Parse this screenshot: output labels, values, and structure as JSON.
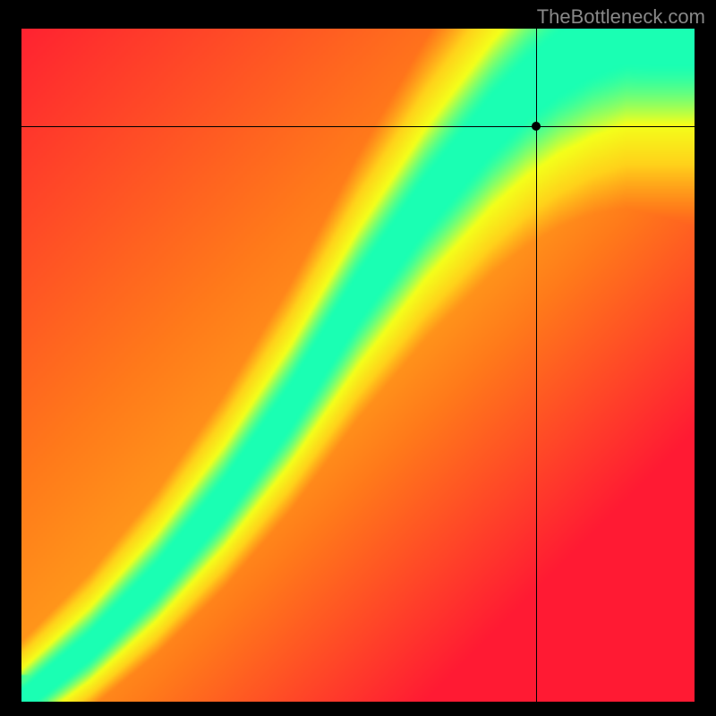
{
  "watermark": "TheBottleneck.com",
  "chart_data": {
    "type": "heatmap",
    "title": "",
    "xlabel": "",
    "ylabel": "",
    "xlim": [
      0,
      1
    ],
    "ylim": [
      0,
      1
    ],
    "grid": false,
    "legend": false,
    "marker": {
      "x": 0.765,
      "y": 0.855
    },
    "crosshair": {
      "x": 0.765,
      "y": 0.855
    },
    "colormap": [
      "#ff1a33",
      "#ff7a1a",
      "#ffd21a",
      "#f4ff1a",
      "#1affb3"
    ],
    "ridge": {
      "description": "optimal diagonal band (green) from bottom-left toward upper-right, with slight S-curve",
      "points_xy": [
        [
          0.0,
          0.0
        ],
        [
          0.05,
          0.04
        ],
        [
          0.1,
          0.08
        ],
        [
          0.15,
          0.13
        ],
        [
          0.2,
          0.18
        ],
        [
          0.25,
          0.24
        ],
        [
          0.3,
          0.3
        ],
        [
          0.35,
          0.37
        ],
        [
          0.4,
          0.44
        ],
        [
          0.45,
          0.52
        ],
        [
          0.5,
          0.6
        ],
        [
          0.55,
          0.67
        ],
        [
          0.6,
          0.74
        ],
        [
          0.65,
          0.8
        ],
        [
          0.7,
          0.86
        ],
        [
          0.75,
          0.91
        ],
        [
          0.8,
          0.95
        ],
        [
          0.85,
          0.98
        ],
        [
          0.9,
          1.0
        ]
      ],
      "band_halfwidth": 0.045
    },
    "corner_values": {
      "bottom_left": "green_origin",
      "top_left": "red",
      "bottom_right": "red",
      "top_right": "yellow"
    }
  },
  "colors": {
    "background": "#000000",
    "watermark": "#888888",
    "crosshair": "#000000",
    "marker": "#000000"
  }
}
